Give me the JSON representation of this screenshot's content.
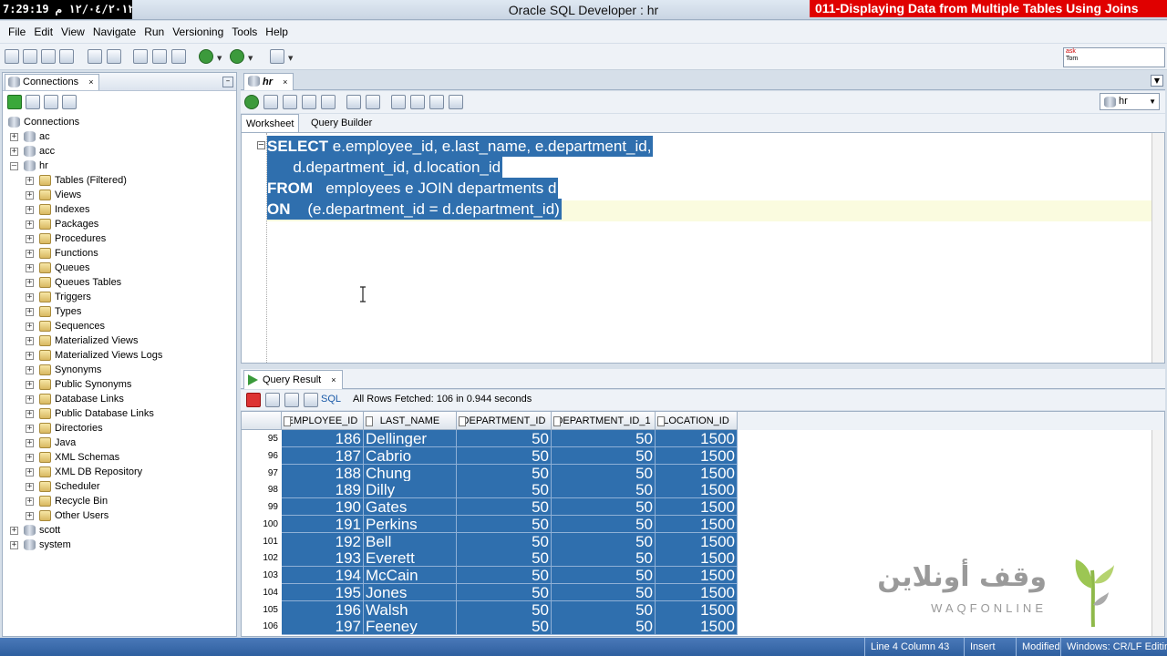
{
  "titlebar": {
    "clock": "7:29:19 ١٢/٠٤/٢٠١٢ م",
    "window_title": "Oracle SQL Developer : hr",
    "video_title": "011-Displaying Data from Multiple Tables Using Joins"
  },
  "menu": [
    "File",
    "Edit",
    "View",
    "Navigate",
    "Run",
    "Versioning",
    "Tools",
    "Help"
  ],
  "ask_box": {
    "line1": "ask",
    "line2": "Tom"
  },
  "connections": {
    "tab_label": "Connections",
    "close": "×",
    "minimize": "–",
    "root_label": "Connections",
    "nodes": [
      {
        "label": "ac",
        "expanded": false
      },
      {
        "label": "acc",
        "expanded": false
      },
      {
        "label": "hr",
        "expanded": true
      }
    ],
    "hr_children": [
      "Tables (Filtered)",
      "Views",
      "Indexes",
      "Packages",
      "Procedures",
      "Functions",
      "Queues",
      "Queues Tables",
      "Triggers",
      "Types",
      "Sequences",
      "Materialized Views",
      "Materialized Views Logs",
      "Synonyms",
      "Public Synonyms",
      "Database Links",
      "Public Database Links",
      "Directories",
      "Java",
      "XML Schemas",
      "XML DB Repository",
      "Scheduler",
      "Recycle Bin",
      "Other Users"
    ],
    "after_nodes": [
      {
        "label": "scott",
        "expanded": false
      },
      {
        "label": "system",
        "expanded": false
      }
    ]
  },
  "editor": {
    "tab_label": "hr",
    "close": "×",
    "connection": "hr",
    "subtabs": {
      "worksheet": "Worksheet",
      "query_builder": "Query Builder"
    },
    "lines": [
      {
        "kw": "SELECT",
        "text": " e.employee_id, e.last_name, e.department_id,"
      },
      {
        "kw": "",
        "text": "      d.department_id, d.location_id"
      },
      {
        "kw": "FROM",
        "text": "   employees e JOIN departments d"
      },
      {
        "kw": "ON",
        "text": "    (e.department_id = d.department_id)"
      }
    ]
  },
  "result": {
    "tab_label": "Query Result",
    "close": "×",
    "sql_label": "SQL",
    "fetched_text": "All Rows Fetched: 106 in 0.944 seconds",
    "columns": [
      "EMPLOYEE_ID",
      "LAST_NAME",
      "DEPARTMENT_ID",
      "DEPARTMENT_ID_1",
      "LOCATION_ID"
    ],
    "rows": [
      {
        "n": "95",
        "emp": "186",
        "name": "Dellinger",
        "dept": "50",
        "dept1": "50",
        "loc": "1500"
      },
      {
        "n": "96",
        "emp": "187",
        "name": "Cabrio",
        "dept": "50",
        "dept1": "50",
        "loc": "1500"
      },
      {
        "n": "97",
        "emp": "188",
        "name": "Chung",
        "dept": "50",
        "dept1": "50",
        "loc": "1500"
      },
      {
        "n": "98",
        "emp": "189",
        "name": "Dilly",
        "dept": "50",
        "dept1": "50",
        "loc": "1500"
      },
      {
        "n": "99",
        "emp": "190",
        "name": "Gates",
        "dept": "50",
        "dept1": "50",
        "loc": "1500"
      },
      {
        "n": "100",
        "emp": "191",
        "name": "Perkins",
        "dept": "50",
        "dept1": "50",
        "loc": "1500"
      },
      {
        "n": "101",
        "emp": "192",
        "name": "Bell",
        "dept": "50",
        "dept1": "50",
        "loc": "1500"
      },
      {
        "n": "102",
        "emp": "193",
        "name": "Everett",
        "dept": "50",
        "dept1": "50",
        "loc": "1500"
      },
      {
        "n": "103",
        "emp": "194",
        "name": "McCain",
        "dept": "50",
        "dept1": "50",
        "loc": "1500"
      },
      {
        "n": "104",
        "emp": "195",
        "name": "Jones",
        "dept": "50",
        "dept1": "50",
        "loc": "1500"
      },
      {
        "n": "105",
        "emp": "196",
        "name": "Walsh",
        "dept": "50",
        "dept1": "50",
        "loc": "1500"
      },
      {
        "n": "106",
        "emp": "197",
        "name": "Feeney",
        "dept": "50",
        "dept1": "50",
        "loc": "1500"
      }
    ]
  },
  "watermark": {
    "arabic": "وقف أونلاين",
    "english": "WAQFONLINE"
  },
  "status": {
    "position": "Line 4 Column 43",
    "mode": "Insert",
    "modified": "Modified",
    "eol": "Windows: CR/LF Editing"
  },
  "colors": {
    "selection": "#2f6fae",
    "status_bar": "#3a6aaa",
    "video_title": "#e00000"
  }
}
